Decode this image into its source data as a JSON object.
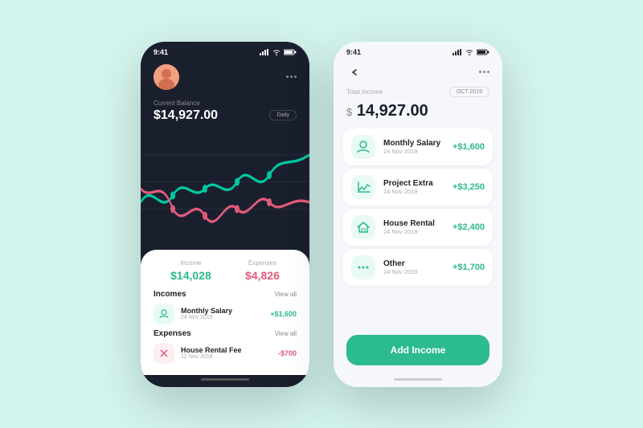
{
  "background_color": "#d4f5ee",
  "phone1": {
    "status_time": "9:41",
    "balance_label": "Current Balance",
    "balance_amount": "$14,927.00",
    "period": "Daily",
    "income_label": "Income",
    "income_value": "$14,028",
    "expenses_label": "Expenses",
    "expenses_value": "$4,826",
    "incomes_section": "Incomes",
    "view_all": "View all",
    "expenses_section": "Expenses",
    "income_item": {
      "name": "Monthly Salary",
      "date": "24 Nov 2019",
      "amount": "+$1,600"
    },
    "expense_item": {
      "name": "House Rental Fee",
      "date": "12 Nov 2019",
      "amount": "-$700"
    }
  },
  "phone2": {
    "status_time": "9:41",
    "total_income_label": "Total Income",
    "period_badge": "OCT 2019",
    "total_amount_prefix": "$",
    "total_amount": " 14,927.00",
    "add_income_btn": "Add Income",
    "items": [
      {
        "name": "Monthly Salary",
        "date": "24 Nov 2019",
        "amount": "+$1,600",
        "icon": "salary"
      },
      {
        "name": "Project Extra",
        "date": "24 Nov 2019",
        "amount": "+$3,250",
        "icon": "project"
      },
      {
        "name": "House Rental",
        "date": "24 Nov 2019",
        "amount": "+$2,400",
        "icon": "house"
      },
      {
        "name": "Other",
        "date": "24 Nov 2019",
        "amount": "+$1,700",
        "icon": "other"
      }
    ]
  },
  "icons": {
    "signal": "▐▐▐",
    "wifi": "WiFi",
    "battery": "▭"
  }
}
